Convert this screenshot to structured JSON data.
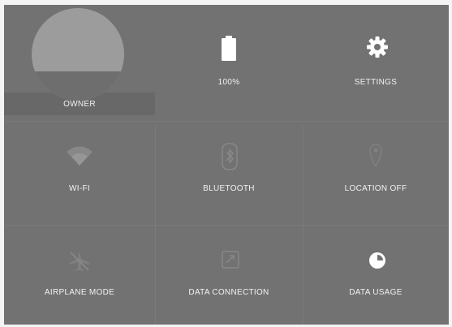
{
  "quick_settings": {
    "owner": {
      "label": "OWNER",
      "icon": "avatar"
    },
    "battery": {
      "label": "100%",
      "icon": "battery-icon"
    },
    "settings": {
      "label": "SETTINGS",
      "icon": "gear-icon"
    },
    "wifi": {
      "label": "WI-FI",
      "icon": "wifi-icon"
    },
    "bluetooth": {
      "label": "BLUETOOTH",
      "icon": "bluetooth-icon"
    },
    "location": {
      "label": "LOCATION OFF",
      "icon": "location-icon"
    },
    "airplane": {
      "label": "AIRPLANE MODE",
      "icon": "airplane-icon"
    },
    "data_connection": {
      "label": "DATA CONNECTION",
      "icon": "data-connection-icon"
    },
    "data_usage": {
      "label": "DATA USAGE",
      "icon": "data-usage-icon"
    }
  },
  "colors": {
    "panel_background": "#727272",
    "text": "#f2f2f2",
    "icon_active": "#ffffff",
    "icon_inactive": "#8e8e8e"
  }
}
